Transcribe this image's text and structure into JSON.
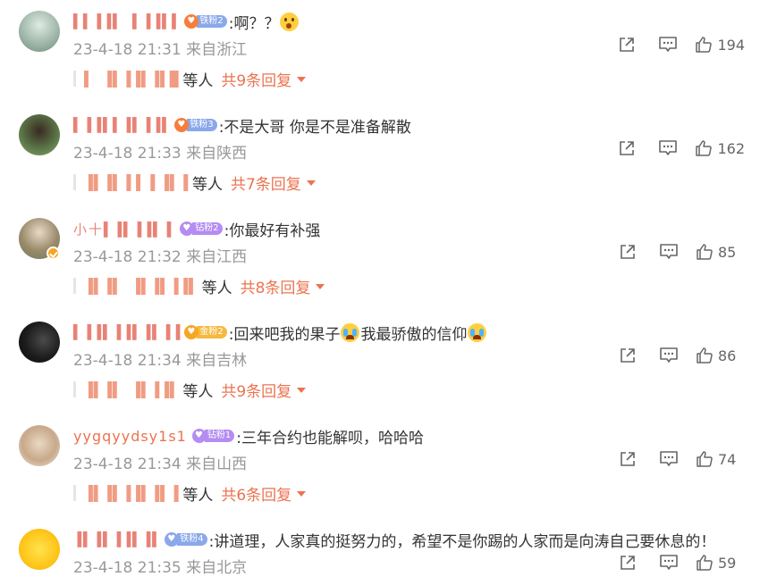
{
  "comments": [
    {
      "username": "▌▌▐▐▌ ▌▐▐▌▌",
      "fan_badge": "铁粉2",
      "fan_type": "iron",
      "text": ":啊？？",
      "text_suffix": "",
      "emoji_after": "shock-emoji",
      "time": "23-4-18 21:31",
      "location": "来自浙江",
      "likes": "194",
      "reply_names": "▌ ▐▌▐▐▌▐▌█",
      "reply_suffix": "等人",
      "reply_total": "共9条回复"
    },
    {
      "username": "▌▐▐▌▌▐▌▐▐▌",
      "fan_badge": "铁粉3",
      "fan_type": "iron",
      "text": ":不是大哥 你是不是准备解散",
      "text_suffix": "",
      "emoji_after": "",
      "time": "23-4-18 21:33",
      "location": "来自陕西",
      "likes": "162",
      "reply_names": "▐▌▐▌▐▐ ▌▐▌▐",
      "reply_suffix": "等人",
      "reply_total": "共7条回复"
    },
    {
      "username": "小十▌▐▌▐▐▌▐",
      "fan_badge": "钻粉2",
      "fan_type": "diamond",
      "text": ":你最好有补强",
      "text_suffix": "",
      "emoji_after": "",
      "time": "23-4-18 21:32",
      "location": "来自江西",
      "likes": "85",
      "reply_names": "▐▌▐▌ ▐▌▐▌▐▐▌",
      "reply_suffix": "等人",
      "reply_total": "共8条回复"
    },
    {
      "username": "▌▐▐▌▐▐▌▐▌▐▐",
      "fan_badge": "金粉2",
      "fan_type": "gold",
      "text": ":回来吧我的果子",
      "text_suffix": "我最骄傲的信仰",
      "emoji_after": "cry-emoji",
      "time": "23-4-18 21:34",
      "location": "来自吉林",
      "likes": "86",
      "reply_names": "▐▌▐▌ ▐▌▐▐▌",
      "reply_suffix": "等人",
      "reply_total": "共9条回复"
    },
    {
      "username": "yygqyydsy1s1",
      "fan_badge": "钻粉1",
      "fan_type": "diamond",
      "text": ":三年合约也能解呗，哈哈哈",
      "text_suffix": "",
      "emoji_after": "",
      "time": "23-4-18 21:34",
      "location": "来自山西",
      "likes": "74",
      "reply_names": "▐▌▐▌▐▐▌▐▌▐",
      "reply_suffix": "等人",
      "reply_total": "共6条回复"
    },
    {
      "username": "▐▌▐▌▐▐▌▐▌",
      "fan_badge": "铁粉4",
      "fan_type": "iron",
      "text": ":讲道理，人家真的挺努力的，希望不是你踢的人家而是向涛自己要休息的！",
      "text_suffix": "",
      "emoji_after": "",
      "time": "23-4-18 21:35",
      "location": "来自北京",
      "likes": "59",
      "reply_names": "",
      "reply_suffix": "",
      "reply_total": ""
    }
  ],
  "colors": {
    "accent": "#eb7350",
    "meta_text": "#999999",
    "body_text": "#333333"
  },
  "icons": {
    "share": "share-icon",
    "reply": "comment-icon",
    "like": "thumb-up-icon"
  }
}
